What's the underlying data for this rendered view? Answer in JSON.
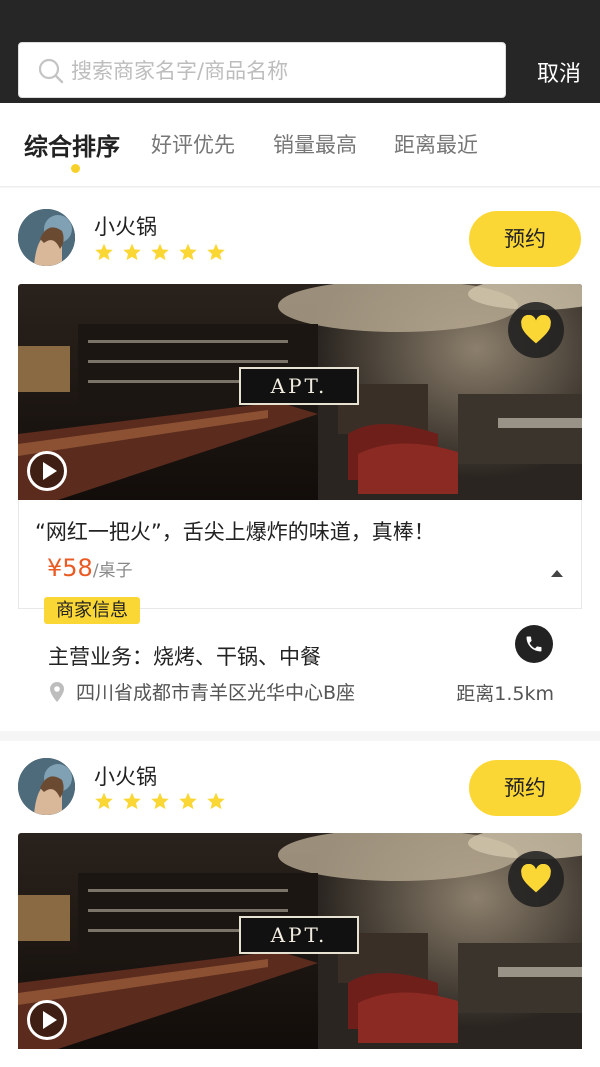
{
  "search": {
    "placeholder": "搜索商家名字/商品名称",
    "cancel_label": "取消",
    "icon": "search-icon"
  },
  "sort_tabs": [
    {
      "label": "综合排序",
      "active": true
    },
    {
      "label": "好评优先",
      "active": false
    },
    {
      "label": "销量最高",
      "active": false
    },
    {
      "label": "距离最近",
      "active": false
    }
  ],
  "colors": {
    "accent": "#fbd736",
    "price": "#ea5b24",
    "topbar": "#262626"
  },
  "listings": [
    {
      "name": "小火锅",
      "rating": 5,
      "book_label": "预约",
      "photo_sign": "APT.",
      "slogan": "“网红一把火”，舌尖上爆炸的味道，真棒！",
      "price": "¥58",
      "unit": "/桌子",
      "merchant_tag": "商家信息",
      "business": "主营业务：烧烤、干锅、中餐",
      "address": "四川省成都市青羊区光华中心B座",
      "distance": "距离1.5km"
    },
    {
      "name": "小火锅",
      "rating": 5,
      "book_label": "预约",
      "photo_sign": "APT."
    }
  ]
}
